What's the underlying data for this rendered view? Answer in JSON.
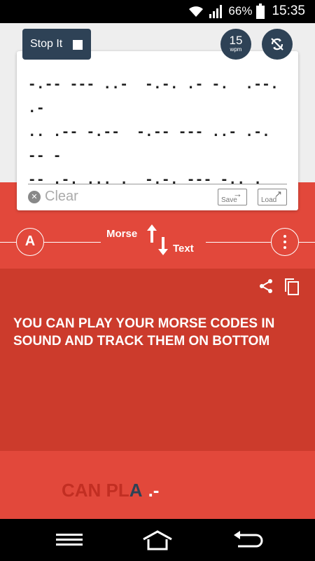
{
  "status_bar": {
    "battery_percent": "66%",
    "time": "15:35"
  },
  "controls": {
    "stop_label": "Stop It",
    "wpm_value": "15",
    "wpm_unit": "wpm"
  },
  "morse_input": {
    "text": "-.-- --- ..-  -.-. .- -.  .--. .-\n.. .-- -.--  -.-- --- ..- .-.  -- -\n-- .-. ... .  -.-. --- -.. . ...  ..\n-.  ... --- ..- -. -..  .- -. -..\n_  _   _ _  _   _ _  _    __   ___",
    "clear_label": "Clear",
    "save_label": "Save",
    "load_label": "Load"
  },
  "direction": {
    "from_label": "Morse",
    "to_label": "Text",
    "font_button_label": "A"
  },
  "translation": {
    "text": "YOU CAN PLAY YOUR MORSE CODES IN SOUND AND TRACK THEM ON BOTTOM"
  },
  "playback": {
    "played_text": "CAN PL",
    "current_letter": "A",
    "current_morse": ".-"
  },
  "colors": {
    "accent_red": "#e2483b",
    "panel_red": "#cc3b2c",
    "dark_navy": "#2e4256"
  }
}
